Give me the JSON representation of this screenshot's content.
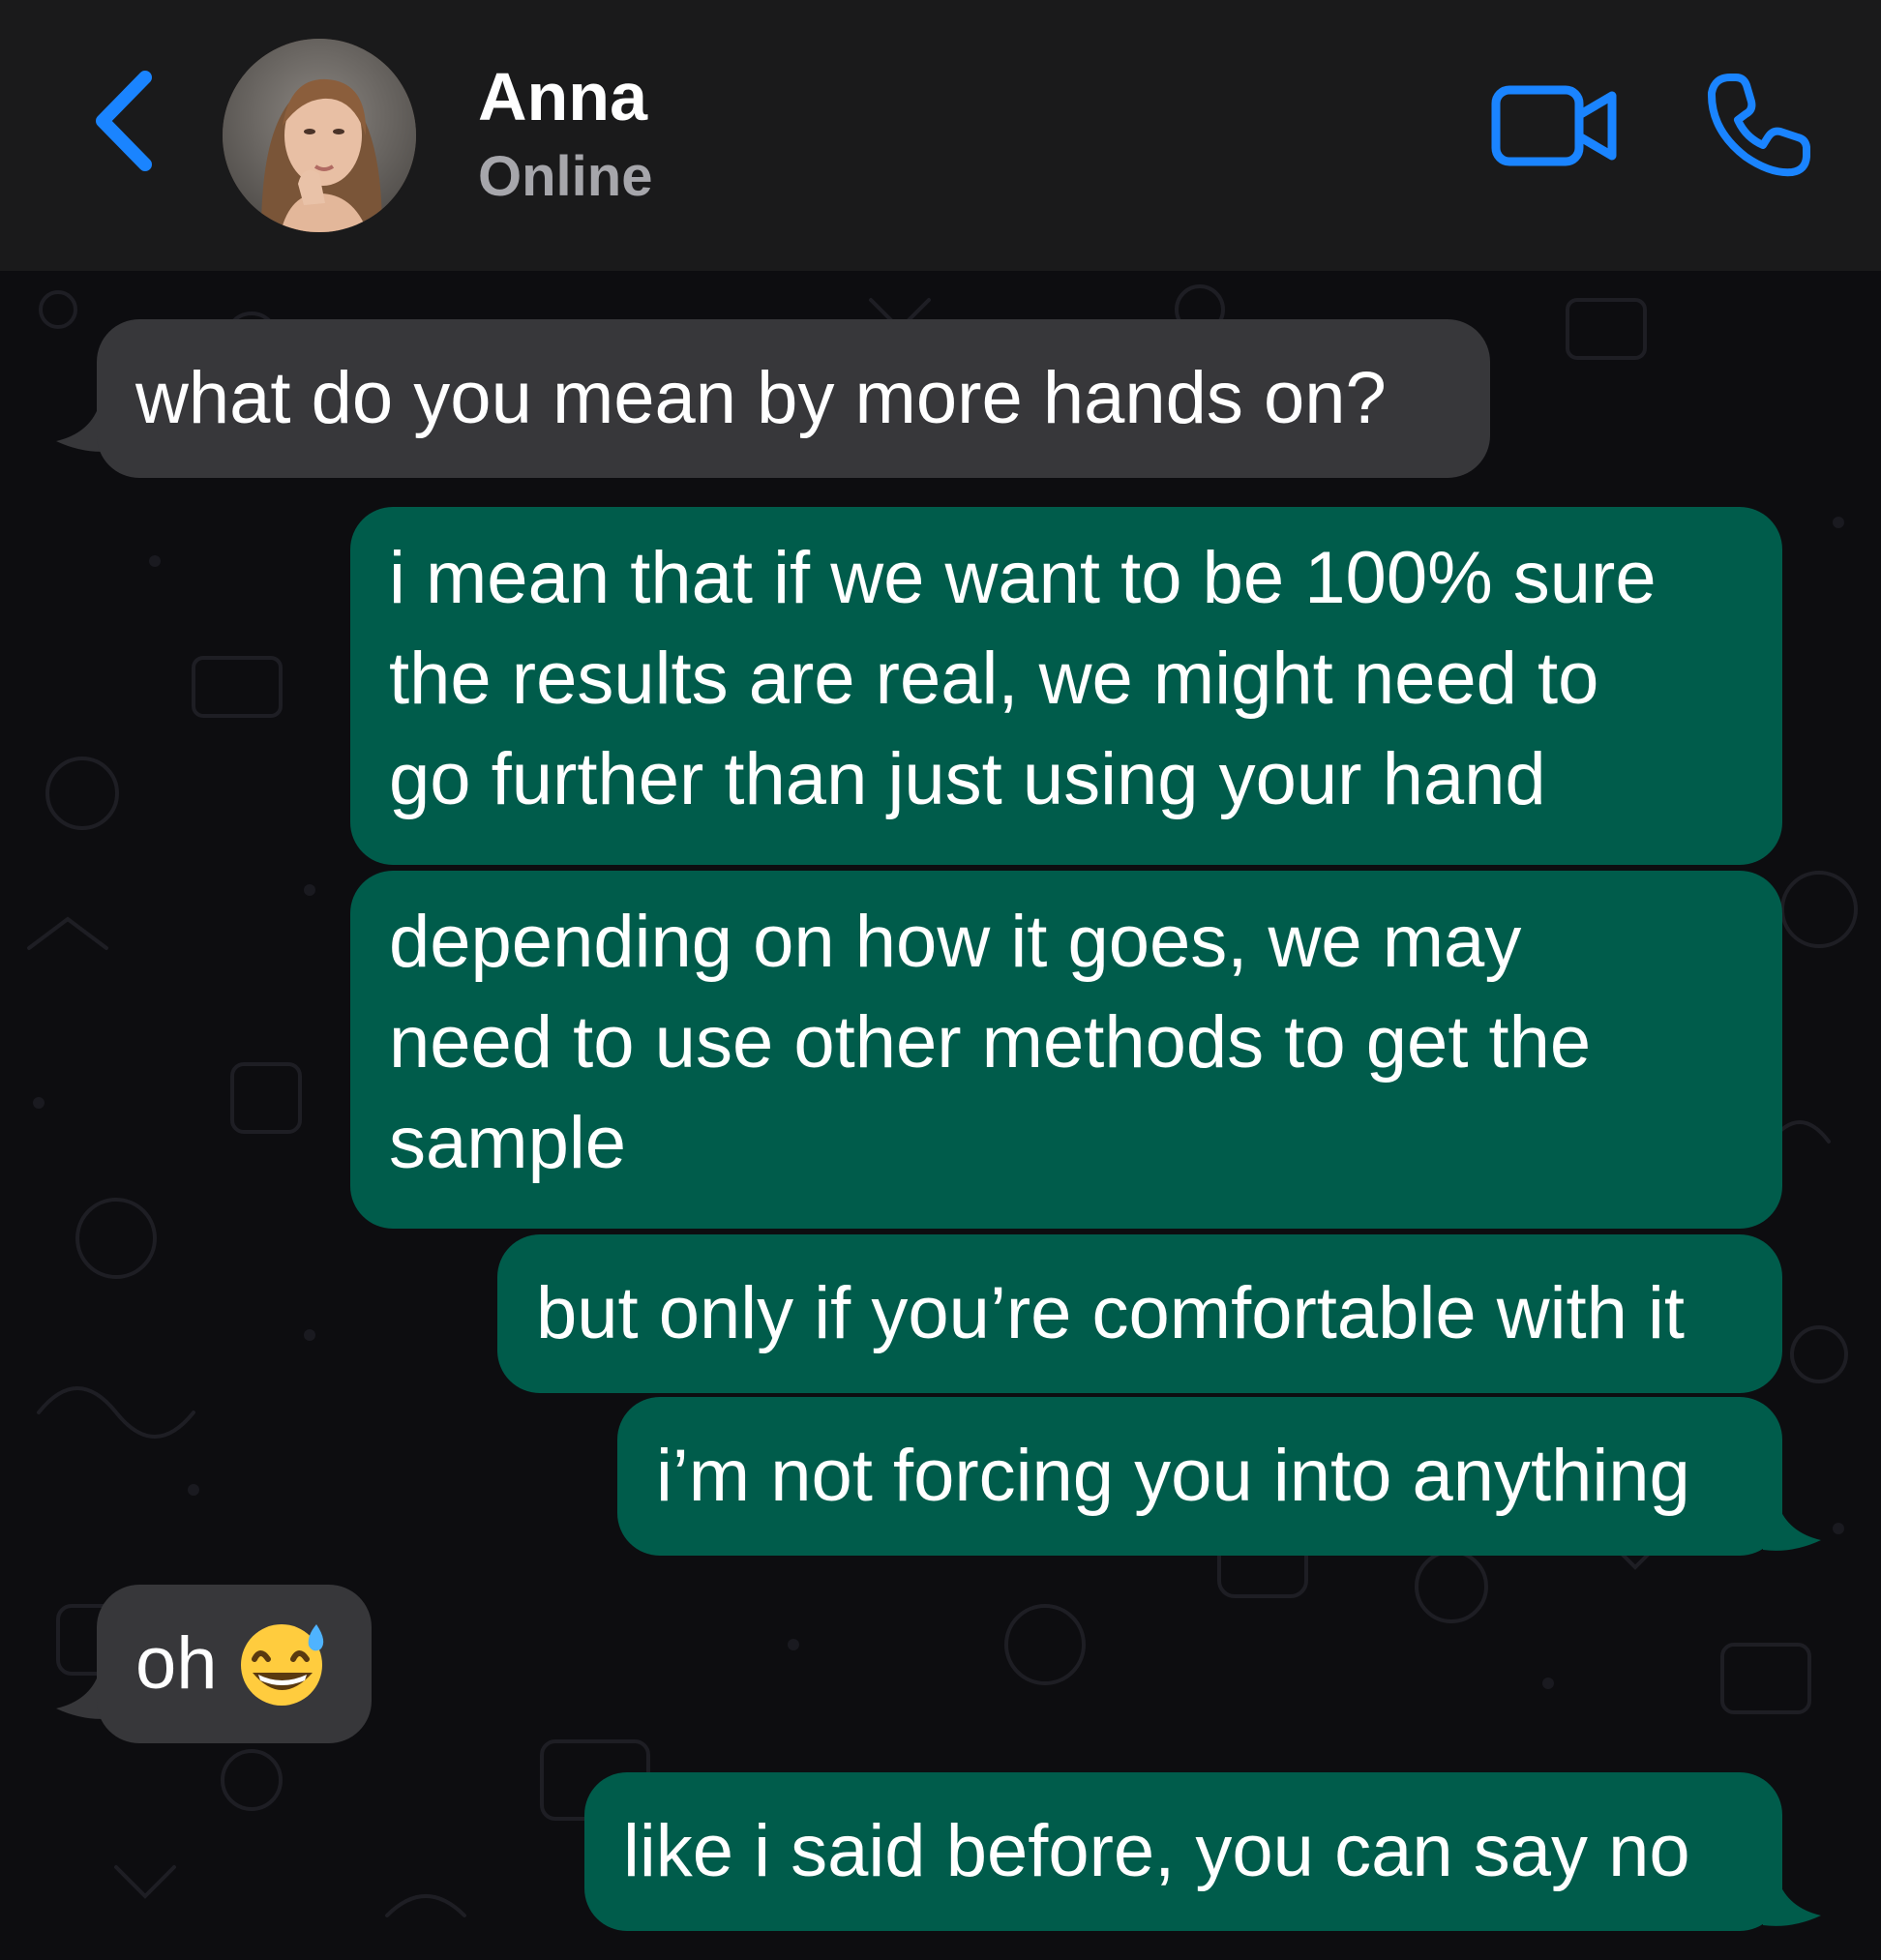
{
  "header": {
    "contact_name": "Anna",
    "status": "Online",
    "accent_color": "#1a84ff"
  },
  "icons": {
    "back": "chevron-left-icon",
    "video": "video-camera-icon",
    "call": "phone-icon"
  },
  "messages": [
    {
      "direction": "incoming",
      "text": "what do you mean by more hands on?"
    },
    {
      "direction": "outgoing",
      "lines": [
        "i mean that if we want to be 100% sure",
        "the results are real, we might need to",
        "go further than just using your hand"
      ]
    },
    {
      "direction": "outgoing",
      "lines": [
        "depending on how it goes, we may",
        "need to use other methods to get the",
        "sample"
      ]
    },
    {
      "direction": "outgoing",
      "text": "but only if you’re comfortable with it"
    },
    {
      "direction": "outgoing",
      "text": "i’m not forcing you into anything"
    },
    {
      "direction": "incoming",
      "text": "oh",
      "emoji": "grinning-face-with-sweat"
    },
    {
      "direction": "outgoing",
      "text": "like i said before, you can say no"
    }
  ],
  "colors": {
    "incoming_bubble": "#37373a",
    "outgoing_bubble": "#005c4b",
    "header_bg": "#1a1a1b",
    "chat_bg": "#0d0d10"
  }
}
